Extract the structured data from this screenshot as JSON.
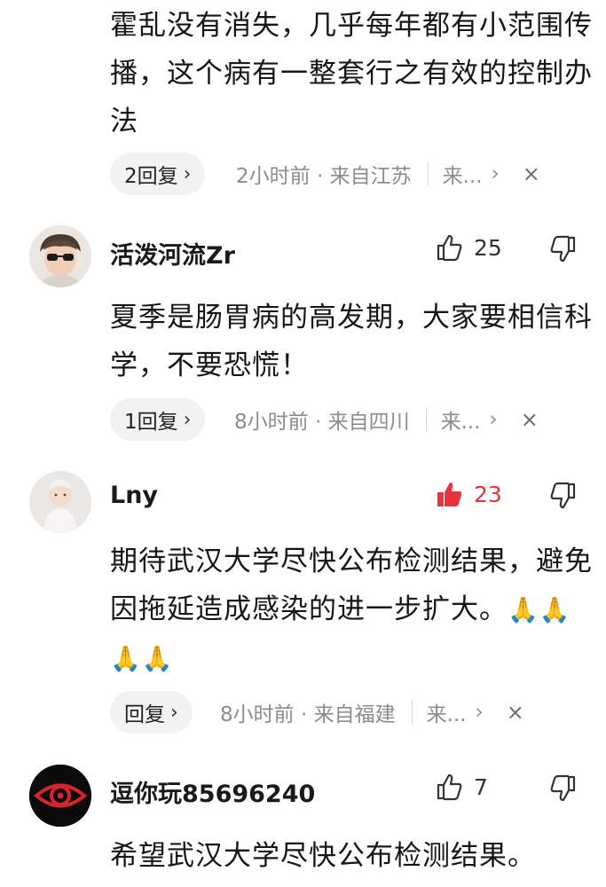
{
  "comments": [
    {
      "text": "霍乱没有消失，几乎每年都有小范围传播，这个病有一整套行之有效的控制办法",
      "replies": "2回复",
      "meta": "2小时前 · 来自江苏",
      "more": "来..."
    },
    {
      "user": "活泼河流Zr",
      "likes": "25",
      "text": "夏季是肠胃病的高发期，大家要相信科学，不要恐慌！",
      "replies": "1回复",
      "meta": "8小时前 · 来自四川",
      "more": "来..."
    },
    {
      "user": "Lny",
      "likes": "23",
      "text": "期待武汉大学尽快公布检测结果，避免因拖延造成感染的进一步扩大。",
      "emoji": "🙏🙏🙏🙏",
      "replies": "回复",
      "meta": "8小时前 · 来自福建",
      "more": "来..."
    },
    {
      "user": "逗你玩85696240",
      "likes": "7",
      "text": "希望武汉大学尽快公布检测结果。"
    }
  ],
  "icons": {
    "chevron": "›",
    "close": "×",
    "like": "thumbs-up-icon",
    "dislike": "thumbs-down-icon"
  },
  "colors": {
    "liked": "#e8323c",
    "meta": "#8c8c8c"
  }
}
